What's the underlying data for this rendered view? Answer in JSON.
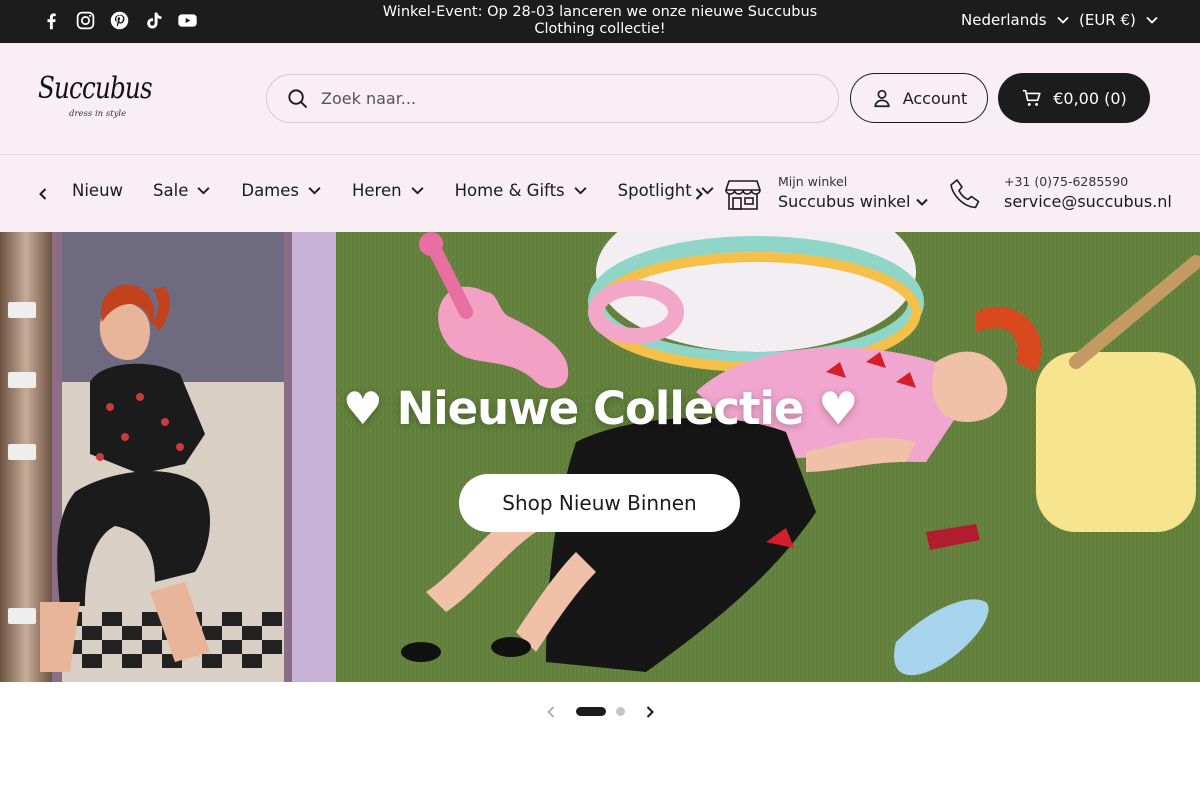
{
  "announcement": {
    "text": "Winkel-Event: Op 28-03 lanceren we onze nieuwe Succubus Clothing collectie!",
    "social_icons": [
      "facebook-icon",
      "instagram-icon",
      "pinterest-icon",
      "tiktok-icon",
      "youtube-icon"
    ],
    "language": "Nederlands",
    "currency": "(EUR €)"
  },
  "header": {
    "logo_text": "Succubus",
    "logo_tagline": "dress in style",
    "search_placeholder": "Zoek naar...",
    "account_label": "Account",
    "cart_label": "€0,00 (0)"
  },
  "nav": {
    "items": [
      {
        "label": "Nieuw",
        "has_dropdown": false
      },
      {
        "label": "Sale",
        "has_dropdown": true
      },
      {
        "label": "Dames",
        "has_dropdown": true
      },
      {
        "label": "Heren",
        "has_dropdown": true
      },
      {
        "label": "Home & Gifts",
        "has_dropdown": true
      },
      {
        "label": "Spotlight",
        "has_dropdown": true
      }
    ],
    "store_caption": "Mijn winkel",
    "store_name": "Succubus winkel",
    "phone": "+31 (0)75-6285590",
    "email": "service@succubus.nl"
  },
  "hero": {
    "title": "♥ Nieuwe Collectie ♥",
    "cta_label": "Shop Nieuw Binnen"
  },
  "carousel": {
    "slide_count": 2,
    "active_slide": 1
  },
  "colors": {
    "topbar": "#1c1c1c",
    "header_bg": "#f8eef4",
    "cart_button": "#1c1c1c",
    "hero_grass": "#5f7d3b"
  }
}
